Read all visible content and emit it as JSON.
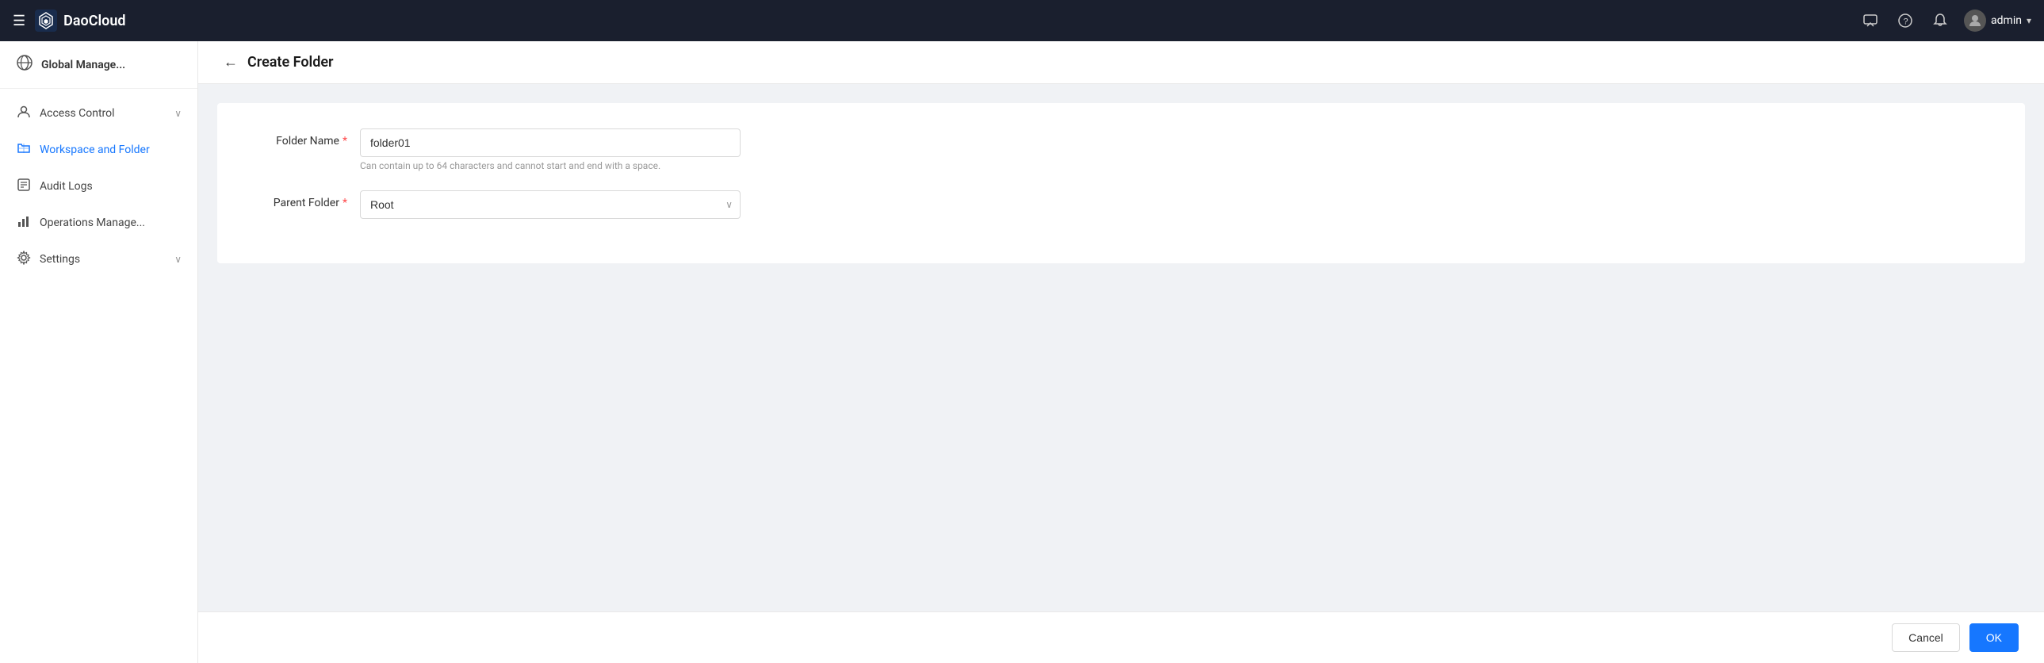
{
  "topbar": {
    "brand": "DaoCloud",
    "user": "admin",
    "icons": {
      "menu": "☰",
      "chat": "💬",
      "help": "❓",
      "bell": "🔔",
      "chevron": "▾"
    }
  },
  "sidebar": {
    "brand_label": "Global Manage...",
    "items": [
      {
        "id": "access-control",
        "label": "Access Control",
        "icon": "👤",
        "has_chevron": true,
        "active": false
      },
      {
        "id": "workspace-folder",
        "label": "Workspace and Folder",
        "icon": "💠",
        "has_chevron": false,
        "active": true
      },
      {
        "id": "audit-logs",
        "label": "Audit Logs",
        "icon": "📊",
        "has_chevron": false,
        "active": false
      },
      {
        "id": "operations-manage",
        "label": "Operations Manage...",
        "icon": "📈",
        "has_chevron": false,
        "active": false
      },
      {
        "id": "settings",
        "label": "Settings",
        "icon": "⚙️",
        "has_chevron": true,
        "active": false
      }
    ]
  },
  "page": {
    "back_button": "←",
    "title": "Create Folder"
  },
  "form": {
    "folder_name_label": "Folder Name",
    "folder_name_required": "*",
    "folder_name_value": "folder01",
    "folder_name_hint": "Can contain up to 64 characters and cannot start and end with a space.",
    "parent_folder_label": "Parent Folder",
    "parent_folder_required": "*",
    "parent_folder_options": [
      "Root"
    ],
    "parent_folder_value": "Root"
  },
  "footer": {
    "cancel_label": "Cancel",
    "ok_label": "OK"
  }
}
